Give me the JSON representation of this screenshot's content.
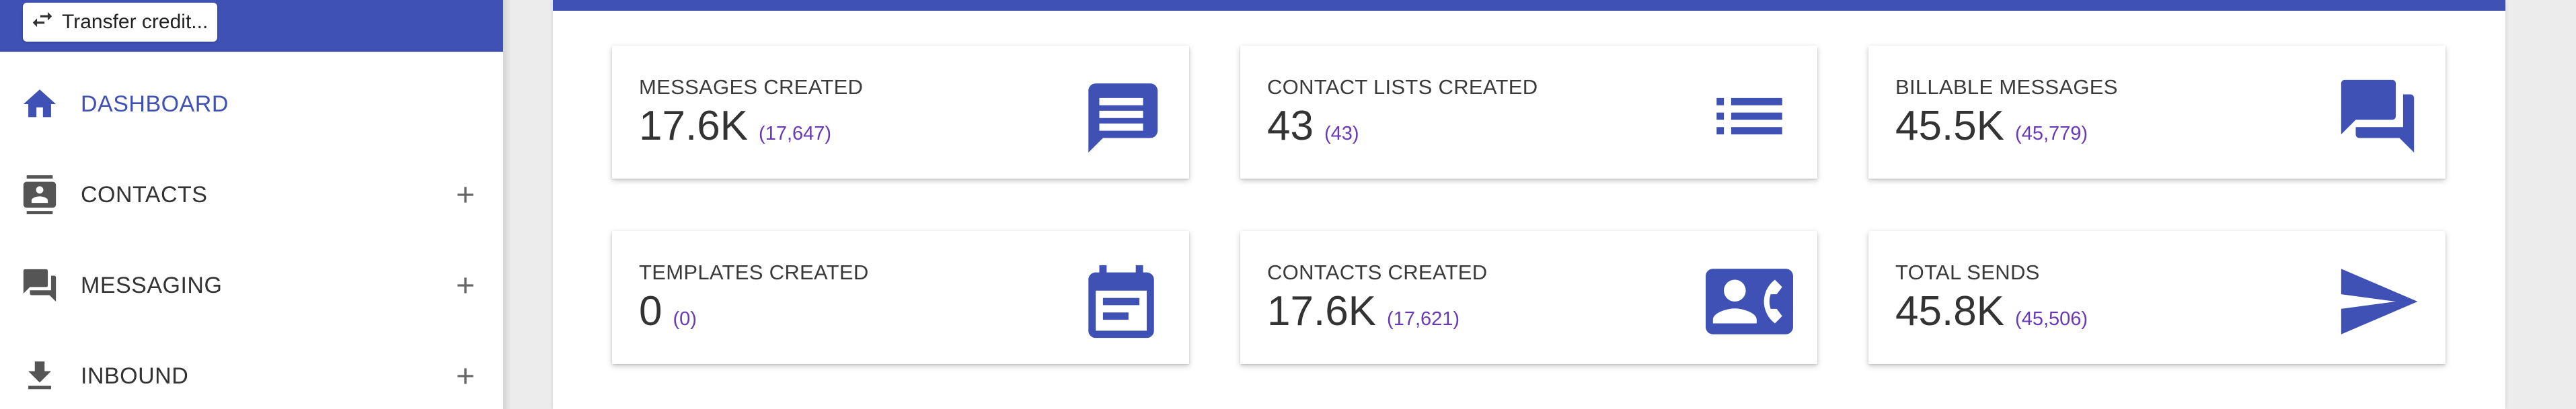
{
  "sidebar": {
    "transfer_button_label": "Transfer credit...",
    "items": [
      {
        "label": "DASHBOARD",
        "icon": "home-icon",
        "expandable": false,
        "active": true
      },
      {
        "label": "CONTACTS",
        "icon": "contacts-icon",
        "expandable": true,
        "active": false
      },
      {
        "label": "MESSAGING",
        "icon": "messaging-icon",
        "expandable": true,
        "active": false
      },
      {
        "label": "INBOUND",
        "icon": "download-icon",
        "expandable": true,
        "active": false
      }
    ]
  },
  "dashboard": {
    "cards": [
      {
        "title": "MESSAGES CREATED",
        "value": "17.6K",
        "exact": "(17,647)",
        "icon": "message-icon"
      },
      {
        "title": "CONTACT LISTS CREATED",
        "value": "43",
        "exact": "(43)",
        "icon": "list-icon"
      },
      {
        "title": "BILLABLE MESSAGES",
        "value": "45.5K",
        "exact": "(45,779)",
        "icon": "forum-icon"
      },
      {
        "title": "TEMPLATES CREATED",
        "value": "0",
        "exact": "(0)",
        "icon": "calendar-icon"
      },
      {
        "title": "CONTACTS CREATED",
        "value": "17.6K",
        "exact": "(17,621)",
        "icon": "contact-phone-icon"
      },
      {
        "title": "TOTAL SENDS",
        "value": "45.8K",
        "exact": "(45,506)",
        "icon": "send-icon"
      }
    ]
  },
  "colors": {
    "primary": "#3f51b5",
    "accent_purple": "#673ab7",
    "background": "#ececec"
  }
}
